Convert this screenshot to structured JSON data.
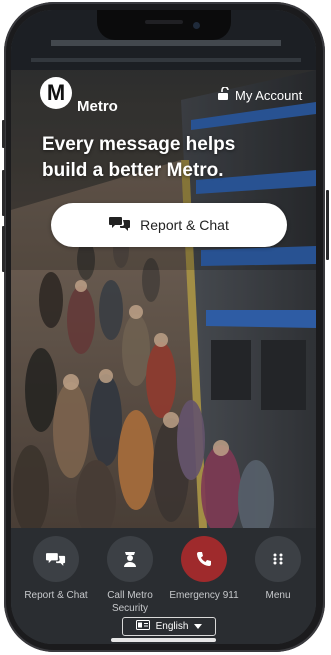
{
  "header": {
    "logo_letter": "M",
    "logo_text": "Metro",
    "account_label": "My Account"
  },
  "hero": {
    "headline": "Every message helps build a better Metro.",
    "report_button_label": "Report & Chat"
  },
  "tabbar": {
    "items": [
      {
        "label": "Report & Chat",
        "icon": "chat-bubbles-icon"
      },
      {
        "label": "Call Metro Security",
        "icon": "security-officer-icon"
      },
      {
        "label": "Emergency 911",
        "icon": "phone-icon"
      },
      {
        "label": "Menu",
        "icon": "grid-dots-icon"
      }
    ]
  },
  "language": {
    "label": "English"
  },
  "colors": {
    "emergency": "#9f2a2c",
    "tabbar_bg": "#2a2d31",
    "button_bg": "#3c4045",
    "text_on_dark": "#ffffff"
  }
}
